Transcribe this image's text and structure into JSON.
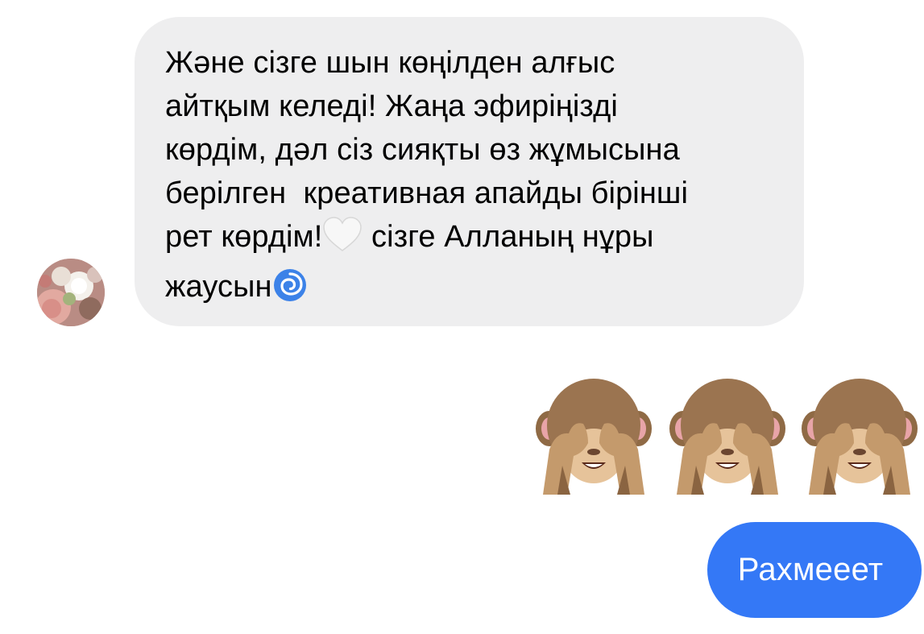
{
  "conversation": {
    "incoming": {
      "lines": [
        "Жəне сізге шын көңілден алғыс",
        "айтқым келеді! Жаңа эфиріңізді",
        "көрдім, дəл сіз сияқты өз жұмысына",
        "берілген  креативная апайды бірінші",
        "рет көрдім!",
        " сізге Алланың нұры",
        "жаусын"
      ],
      "inline_emojis": [
        "white-heart-icon",
        "cyclone-icon"
      ],
      "avatar": "flowers-avatar"
    },
    "reaction": {
      "emojis": [
        "see-no-evil-monkey-icon",
        "see-no-evil-monkey-icon",
        "see-no-evil-monkey-icon"
      ]
    },
    "outgoing": {
      "text": "Рахмееет"
    }
  },
  "colors": {
    "incoming_bubble": "#eeeeef",
    "outgoing_bubble": "#3478f6",
    "outgoing_text": "#ffffff",
    "incoming_text": "#000000"
  }
}
